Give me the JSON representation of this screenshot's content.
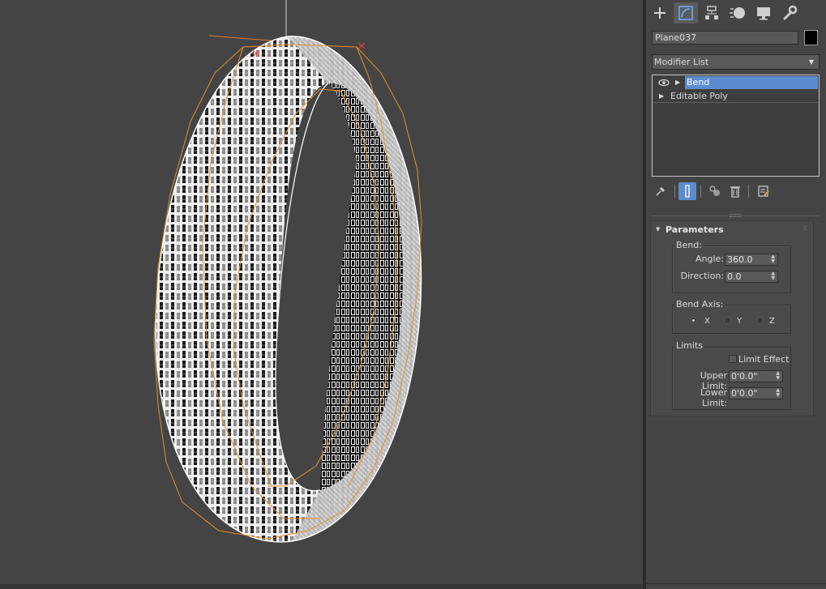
{
  "object": {
    "name": "Plane037",
    "color": "#000000"
  },
  "modifier_list": {
    "label": "Modifier List"
  },
  "stack": {
    "items": [
      {
        "label": "Bend",
        "selected": true
      },
      {
        "label": "Editable Poly",
        "selected": false
      }
    ]
  },
  "tabs": [
    "create-tab",
    "modify-tab",
    "hierarchy-tab",
    "motion-tab",
    "display-tab",
    "utilities-tab"
  ],
  "parameters": {
    "title": "Parameters",
    "bend": {
      "group_label": "Bend:",
      "angle_label": "Angle:",
      "angle_value": "360.0",
      "direction_label": "Direction:",
      "direction_value": "0.0"
    },
    "bend_axis": {
      "group_label": "Bend Axis:",
      "x_label": "X",
      "y_label": "Y",
      "z_label": "Z",
      "selected": "X"
    },
    "limits": {
      "group_label": "Limits",
      "limit_effect_label": "Limit Effect",
      "limit_effect_checked": false,
      "upper_label": "Upper Limit:",
      "upper_value": "0'0.0\"",
      "lower_label": "Lower Limit:",
      "lower_value": "0'0.0\""
    }
  },
  "colors": {
    "selection_highlight": "#5c8ccf",
    "selection_outline": "#e8912a",
    "background": "#444444"
  }
}
